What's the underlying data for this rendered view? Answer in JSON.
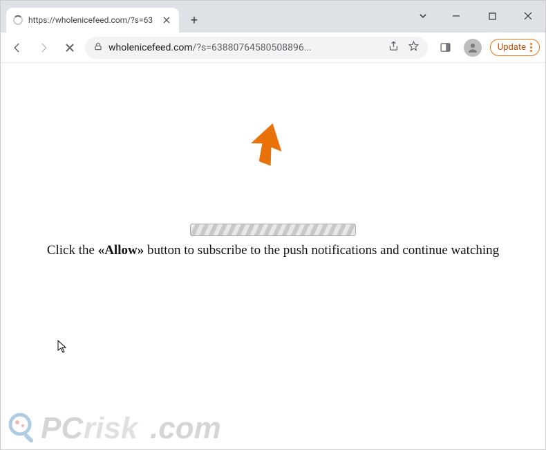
{
  "tab": {
    "title": "https://wholenicefeed.com/?s=63"
  },
  "url": {
    "domain": "wholenicefeed.com",
    "path": "/?s=63880764580508896..."
  },
  "toolbar": {
    "update_label": "Update"
  },
  "page": {
    "msg_prefix": "Click the ",
    "msg_allow": "«Allow»",
    "msg_suffix": " button to subscribe to the push notifications and continue watching"
  },
  "watermark": {
    "brand_pc": "PC",
    "brand_risk": "risk",
    "brand_tld": ".com"
  }
}
